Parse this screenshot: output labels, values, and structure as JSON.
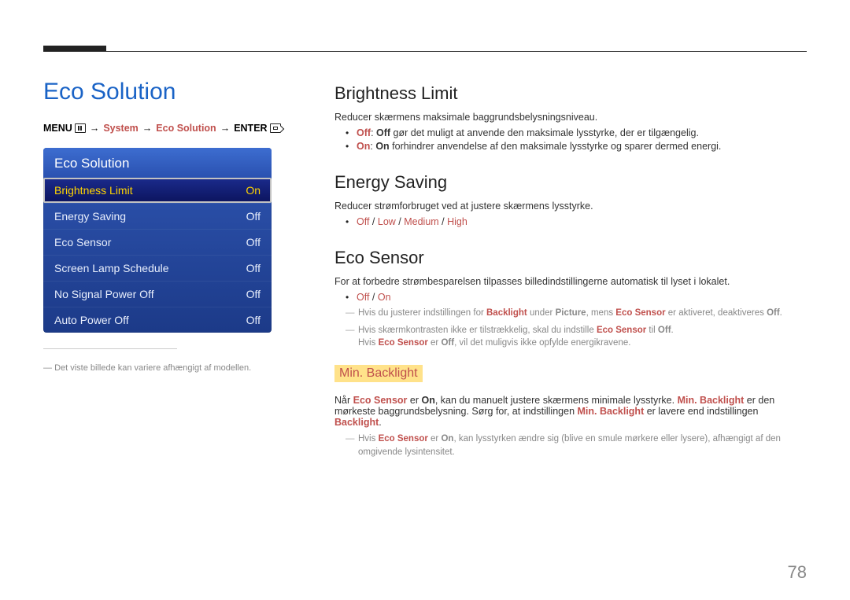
{
  "pageNumber": "78",
  "sectionTitle": "Eco Solution",
  "breadcrumb": {
    "menu": "MENU",
    "arrow": "→",
    "system": "System",
    "eco": "Eco Solution",
    "enter": "ENTER"
  },
  "osd": {
    "title": "Eco Solution",
    "items": [
      {
        "label": "Brightness Limit",
        "value": "On",
        "selected": true
      },
      {
        "label": "Energy Saving",
        "value": "Off"
      },
      {
        "label": "Eco Sensor",
        "value": "Off"
      },
      {
        "label": "Screen Lamp Schedule",
        "value": "Off"
      },
      {
        "label": "No Signal Power Off",
        "value": "Off"
      },
      {
        "label": "Auto Power Off",
        "value": "Off"
      }
    ]
  },
  "osdFootnote": "Det viste billede kan variere afhængigt af modellen.",
  "brightness": {
    "title": "Brightness Limit",
    "desc": "Reducer skærmens maksimale baggrundsbelysningsniveau.",
    "b1a": "Off",
    "b1b": "Off",
    "b1t": " gør det muligt at anvende den maksimale lysstyrke, der er tilgængelig.",
    "b2a": "On",
    "b2b": "On",
    "b2t": " forhindrer anvendelse af den maksimale lysstyrke og sparer dermed energi."
  },
  "energy": {
    "title": "Energy Saving",
    "desc": "Reducer strømforbruget ved at justere skærmens lysstyrke.",
    "opts": {
      "off": "Off",
      "low": "Low",
      "med": "Medium",
      "high": "High",
      "sep": " / "
    }
  },
  "ecosensor": {
    "title": "Eco Sensor",
    "desc": "For at forbedre strømbesparelsen tilpasses billedindstillingerne automatisk til lyset i lokalet.",
    "opts": {
      "off": "Off",
      "on": "On",
      "sep": " / "
    },
    "n1_pre": "Hvis du justerer indstillingen for ",
    "n1_backlight": "Backlight",
    "n1_mid": " under ",
    "n1_picture": "Picture",
    "n1_mid2": ", mens ",
    "n1_eco": "Eco Sensor",
    "n1_mid3": " er aktiveret, deaktiveres ",
    "n1_off": "Off",
    "n1_end": ".",
    "n2_pre": "Hvis skærmkontrasten ikke er tilstrækkelig, skal du indstille ",
    "n2_eco": "Eco Sensor",
    "n2_mid": " til ",
    "n2_off": "Off",
    "n2_end": ".",
    "n2b_pre": "Hvis ",
    "n2b_eco": "Eco Sensor",
    "n2b_mid": " er ",
    "n2b_off": "Off",
    "n2b_end": ", vil det muligvis ikke opfylde energikravene."
  },
  "minbacklight": {
    "title": "Min. Backlight",
    "p_pre": "Når ",
    "p_eco": "Eco Sensor",
    "p_mid": " er ",
    "p_on": "On",
    "p_mid2": ", kan du manuelt justere skærmens minimale lysstyrke. ",
    "p_mb": "Min. Backlight",
    "p_mid3": " er den mørkeste baggrundsbelysning. Sørg for, at indstillingen ",
    "p_mb2": "Min. Backlight",
    "p_mid4": " er lavere end indstillingen ",
    "p_bk": "Backlight",
    "p_end": ".",
    "n_pre": "Hvis ",
    "n_eco": "Eco Sensor",
    "n_mid": " er ",
    "n_on": "On",
    "n_end": ", kan lysstyrken ændre sig (blive en smule mørkere eller lysere), afhængigt af den omgivende lysintensitet."
  }
}
